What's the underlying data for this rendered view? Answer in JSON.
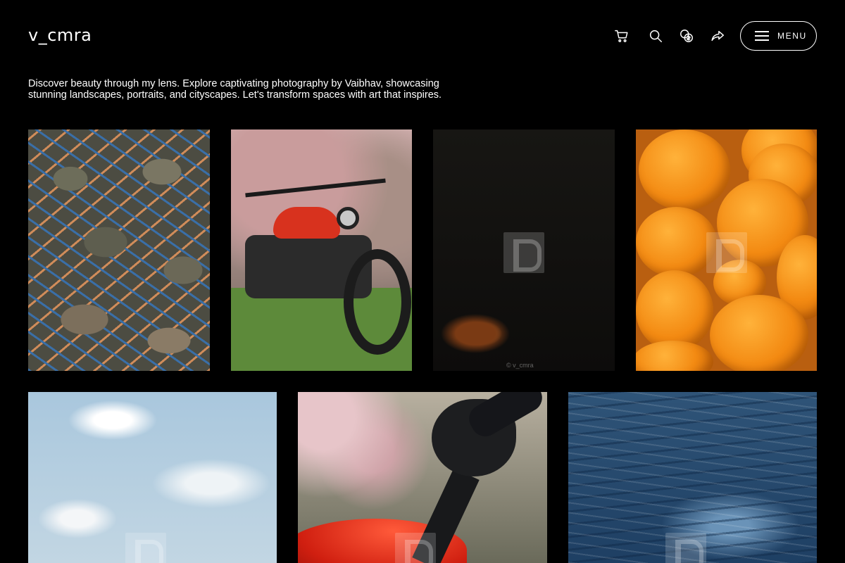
{
  "header": {
    "logo": "v_cmra",
    "icons": [
      {
        "name": "cart-icon"
      },
      {
        "name": "search-icon"
      },
      {
        "name": "currency-icon"
      },
      {
        "name": "share-icon"
      }
    ],
    "menu_label": "MENU"
  },
  "tagline": "Discover beauty through my lens. Explore captivating photography by Vaibhav, showcasing stunning landscapes, portraits, and cityscapes. Let's transform spaces with art that inspires.",
  "gallery": {
    "items": [
      {
        "subject": "blue crabs"
      },
      {
        "subject": "red motorcycle on grass"
      },
      {
        "subject": "dark firelight scene",
        "credit": "© v_cmra"
      },
      {
        "subject": "orange pumpkins"
      },
      {
        "subject": "cloudy sky"
      },
      {
        "subject": "motorcycle mirror and red tank"
      },
      {
        "subject": "ocean waves"
      }
    ]
  },
  "colors": {
    "background": "#000000",
    "text": "#ffffff"
  }
}
